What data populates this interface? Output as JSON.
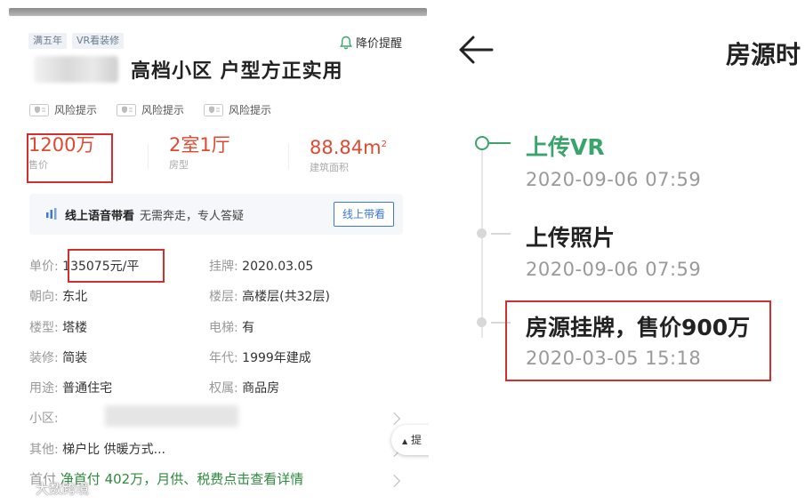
{
  "left": {
    "tags": [
      "满五年",
      "VR看装修"
    ],
    "price_alert": "降价提醒",
    "title": "高档小区 户型方正实用",
    "risk_items": [
      "风险提示",
      "风险提示",
      "风险提示"
    ],
    "stats": [
      {
        "value": "1200万",
        "label": "售价"
      },
      {
        "value": "2室1厅",
        "label": "房型"
      },
      {
        "value": "88.84m",
        "sup": "2",
        "label": "建筑面积"
      }
    ],
    "voice": {
      "main": "线上语音带看",
      "sub": "无需奔走，专人答疑",
      "button": "线上带看"
    },
    "details": [
      {
        "key": "单价:",
        "value": "135075元/平"
      },
      {
        "key": "挂牌:",
        "value": "2020.03.05"
      },
      {
        "key": "朝向:",
        "value": "东北"
      },
      {
        "key": "楼层:",
        "value": "高楼层(共32层)"
      },
      {
        "key": "楼型:",
        "value": "塔楼"
      },
      {
        "key": "电梯:",
        "value": "有"
      },
      {
        "key": "装修:",
        "value": "简装"
      },
      {
        "key": "年代:",
        "value": "1999年建成"
      },
      {
        "key": "用途:",
        "value": "普通住宅"
      },
      {
        "key": "权属:",
        "value": "商品房"
      },
      {
        "key": "小区:",
        "value": ""
      },
      {
        "key": "其他:",
        "value": "梯户比 供暖方式..."
      }
    ],
    "float_button": "提",
    "down_payment_key": "首付",
    "down_payment_text": "净首付 402万，月供、税费点击查看详情",
    "watermark": "大数跨境"
  },
  "right": {
    "title": "房源时",
    "events": [
      {
        "title": "上传VR",
        "time": "2020-09-06 07:59",
        "active": true
      },
      {
        "title": "上传照片",
        "time": "2020-09-06 07:59",
        "active": false
      },
      {
        "title": "房源挂牌，售价900万",
        "time": "2020-03-05 15:18",
        "active": false
      }
    ]
  },
  "colors": {
    "price_red": "#e0492f",
    "highlight_red": "#d32f2f",
    "timeline_green": "#3aa56b",
    "link_blue": "#3c78d8",
    "down_payment_green": "#2e8b3d"
  }
}
